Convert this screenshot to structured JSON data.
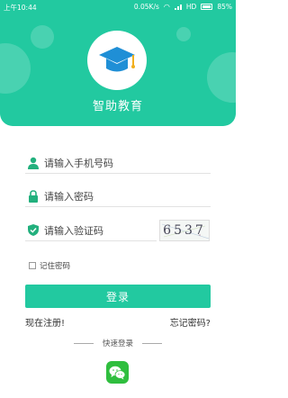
{
  "status_bar": {
    "time": "上午10:44",
    "network_speed": "0.05K/s",
    "network_type": "HD",
    "battery": "85%"
  },
  "app": {
    "title": "智助教育",
    "logo_icon": "graduation-cap-icon"
  },
  "form": {
    "phone_placeholder": "请输入手机号码",
    "password_placeholder": "请输入密码",
    "code_placeholder": "请输入验证码",
    "captcha_text": "6537",
    "remember_label": "记住密码",
    "remember_checked": false
  },
  "actions": {
    "login_label": "登录",
    "register_label": "现在注册!",
    "forgot_label": "忘记密码?"
  },
  "quick_login": {
    "label": "快速登录",
    "wechat_icon": "wechat-icon"
  },
  "colors": {
    "primary": "#22c9a0",
    "wechat": "#2fbe3e",
    "icon_blue": "#1f8fd6",
    "icon_green": "#22b07d"
  }
}
